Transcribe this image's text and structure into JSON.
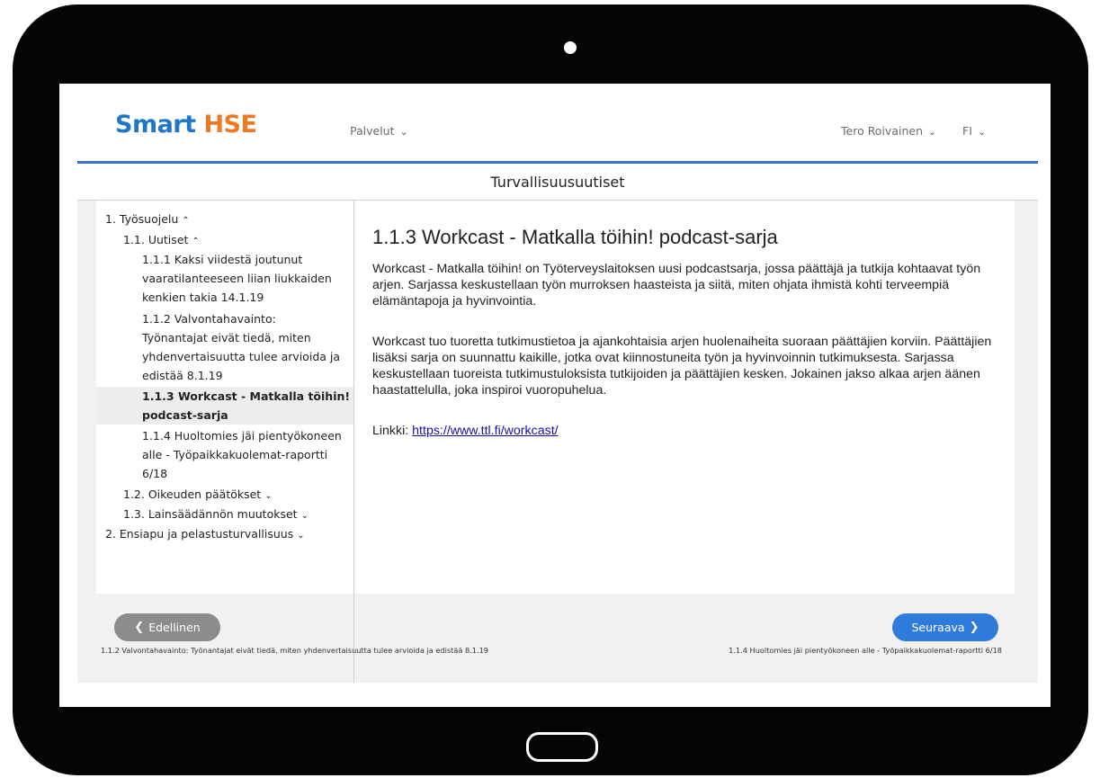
{
  "header": {
    "logo_part1": "Smart",
    "logo_part2": "HSE",
    "services_menu": "Palvelut",
    "user_menu": "Tero Roivainen",
    "language_menu": "FI"
  },
  "page_title": "Turvallisuusuutiset",
  "sidebar": {
    "items": [
      {
        "label": "1. Työsuojelu",
        "state": "expanded"
      },
      {
        "label": "1.1. Uutiset",
        "state": "expanded"
      },
      {
        "lines": [
          "1.1.1 Kaksi viidestä joutunut",
          "vaaratilanteeseen liian liukkaiden",
          "kenkien takia 14.1.19"
        ]
      },
      {
        "lines": [
          "1.1.2 Valvontahavainto:",
          "Työnantajat eivät tiedä, miten",
          "yhdenvertaisuutta tulee arvioida ja",
          "edistää 8.1.19"
        ]
      },
      {
        "lines": [
          "1.1.3 Workcast - Matkalla töihin!",
          "podcast-sarja"
        ],
        "active": true
      },
      {
        "lines": [
          "1.1.4 Huoltomies jäi pientyökoneen",
          "alle - Työpaikkakuolemat-raportti",
          "6/18"
        ]
      },
      {
        "label": "1.2. Oikeuden päätökset",
        "state": "collapsed"
      },
      {
        "label": "1.3. Lainsäädännön muutokset",
        "state": "collapsed"
      },
      {
        "label": "2. Ensiapu ja pelastusturvallisuus",
        "state": "collapsed"
      }
    ]
  },
  "article": {
    "title": "1.1.3 Workcast - Matkalla töihin! podcast-sarja",
    "paragraph1": "Workcast - Matkalla töihin! on Työterveyslaitoksen uusi podcastsarja, jossa päättäjä ja tutkija kohtaavat työn arjen. Sarjassa keskustellaan työn murroksen haasteista ja siitä, miten ohjata ihmistä kohti terveempiä elämäntapoja ja hyvinvointia.",
    "paragraph2": "Workcast tuo tuoretta tutkimustietoa ja ajankohtaisia arjen huolenaiheita suoraan päättäjien korviin. Päättäjien lisäksi sarja on suunnattu kaikille, jotka ovat kiinnostuneita työn ja hyvinvoinnin tutkimuksesta. Sarjassa keskustellaan tuoreista tutkimustuloksista tutkijoiden ja päättäjien kesken. Jokainen jakso alkaa arjen äänen haastattelulla, joka inspiroi vuoropuhelua.",
    "link_label": "Linkki:",
    "link_url": "https://www.ttl.fi/workcast/"
  },
  "footer": {
    "prev_label": "Edellinen",
    "next_label": "Seuraava",
    "prev_caption": "1.1.2 Valvontahavainto: Työnantajat eivät tiedä, miten yhdenvertaisuutta tulee arvioida ja edistää 8.1.19",
    "next_caption": "1.1.4 Huoltomies jäi pientyökoneen alle - Työpaikkakuolemat-raportti 6/18"
  },
  "colors": {
    "brand_blue": "#1f77c9",
    "brand_orange": "#ee7a26",
    "primary_button": "#2f7bdc",
    "secondary_button": "#8c8c8c",
    "header_rule": "#3b6fd1"
  }
}
